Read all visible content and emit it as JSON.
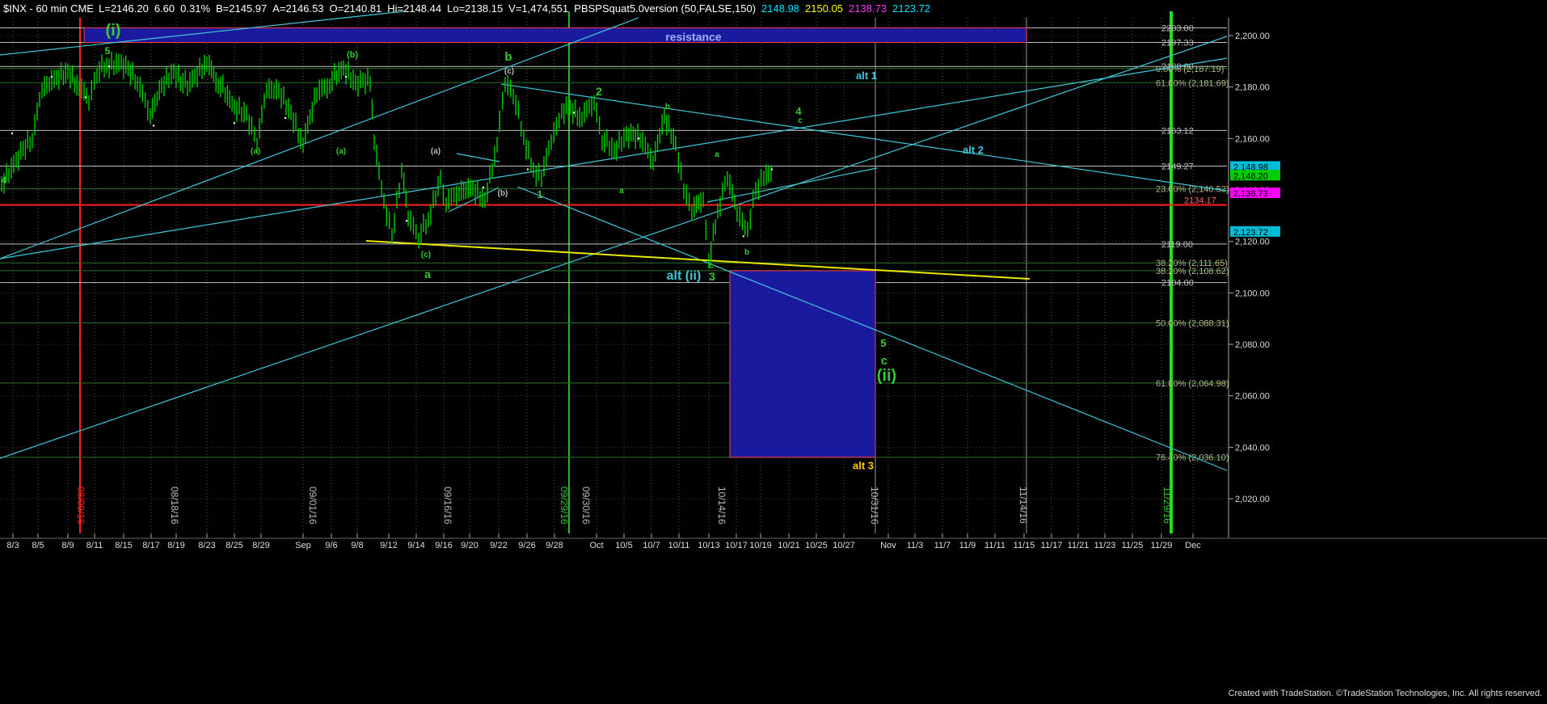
{
  "header": {
    "symbol_text": "$INX - 60 min CME",
    "fields": [
      {
        "text": "L=2146.20",
        "color": "#ffffff"
      },
      {
        "text": "6.60",
        "color": "#ffffff"
      },
      {
        "text": "0.31%",
        "color": "#ffffff"
      },
      {
        "text": "B=2145.97",
        "color": "#ffffff"
      },
      {
        "text": "A=2146.53",
        "color": "#ffffff"
      },
      {
        "text": "O=2140.81",
        "color": "#ffffff"
      },
      {
        "text": "Hi=2148.44",
        "color": "#ffffff"
      },
      {
        "text": "Lo=2138.15",
        "color": "#ffffff"
      },
      {
        "text": "V=1,474,551",
        "color": "#ffffff"
      },
      {
        "text": "PBSPSquat5.0version (50,FALSE,150)",
        "color": "#ffffff"
      },
      {
        "text": "2148.98",
        "color": "#00e5ff"
      },
      {
        "text": "2150.05",
        "color": "#ffff00"
      },
      {
        "text": "2138.73",
        "color": "#ff33ff"
      },
      {
        "text": "2123.72",
        "color": "#00e5ff"
      }
    ]
  },
  "footer": {
    "copyright": "Created with TradeStation. ©TradeStation Technologies, Inc. All rights reserved."
  },
  "colors": {
    "background": "#000000",
    "candle": "#00cc00",
    "cyan": "#3fc8d8",
    "green_label": "#33cc33",
    "red": "#ff2020",
    "yellow": "#e8e800",
    "box": "#1a1a9e"
  },
  "chart_data": {
    "type": "line",
    "title": "$INX - 60 min CME",
    "ylim": [
      2012,
      2218
    ],
    "y_axis_ticks": [
      "2,200.00",
      "2,180.00",
      "2,160.00",
      "2,140.00",
      "2,120.00",
      "2,100.00",
      "2,080.00",
      "2,060.00",
      "2,040.00",
      "2,020.00"
    ],
    "y_tick_values": [
      2200,
      2180,
      2160,
      2140,
      2120,
      2100,
      2080,
      2060,
      2040,
      2020
    ],
    "x_axis_ticks": [
      "8/3",
      "8/5",
      "8/9",
      "8/11",
      "8/15",
      "8/17",
      "8/19",
      "8/23",
      "8/25",
      "8/29",
      "Sep",
      "9/6",
      "9/8",
      "9/12",
      "9/14",
      "9/16",
      "9/20",
      "9/22",
      "9/26",
      "9/28",
      "Oct",
      "10/5",
      "10/7",
      "10/11",
      "10/13",
      "10/17",
      "10/19",
      "10/21",
      "10/25",
      "10/27",
      "Nov",
      "11/3",
      "11/7",
      "11/9",
      "11/11",
      "11/15",
      "11/17",
      "11/21",
      "11/23",
      "11/25",
      "11/29",
      "Dec"
    ],
    "vertical_date_labels": [
      {
        "text": "08/09/16",
        "color": "#ff2020"
      },
      {
        "text": "08/18/16",
        "color": "#bbbbbb"
      },
      {
        "text": "09/01/16",
        "color": "#bbbbbb"
      },
      {
        "text": "09/16/16",
        "color": "#bbbbbb"
      },
      {
        "text": "09/29/16",
        "color": "#33cc33"
      },
      {
        "text": "09/30/16",
        "color": "#bbbbbb"
      },
      {
        "text": "10/14/16",
        "color": "#bbbbbb"
      },
      {
        "text": "10/31/16",
        "color": "#bbbbbb"
      },
      {
        "text": "11/14/16",
        "color": "#bbbbbb"
      },
      {
        "text": "11/29/16",
        "color": "#33cc33"
      }
    ],
    "price_levels": [
      {
        "value": 2203.0,
        "label": "2203.00"
      },
      {
        "value": 2197.33,
        "label": "2197.33"
      },
      {
        "value": 2188.0,
        "label": "2188.00"
      },
      {
        "value": 2163.12,
        "label": "2163.12"
      },
      {
        "value": 2149.27,
        "label": "2149.27"
      },
      {
        "value": 2119.0,
        "label": "2119.00"
      },
      {
        "value": 2104.0,
        "label": "2104.00"
      }
    ],
    "fib_levels": [
      {
        "value": 2187.19,
        "label": "0.00% (2,187.19)"
      },
      {
        "value": 2181.69,
        "label": "61.80% (2,181.69)"
      },
      {
        "value": 2140.52,
        "label": "23.60% (2,140.52)"
      },
      {
        "value": 2111.65,
        "label": "38.20% (2,111.65)"
      },
      {
        "value": 2108.62,
        "label": "38.20% (2,108.62)"
      },
      {
        "value": 2088.31,
        "label": "50.00% (2,088.31)"
      },
      {
        "value": 2064.98,
        "label": "61.80% (2,064.98)"
      },
      {
        "value": 2036.1,
        "label": "76.40% (2,036.10)"
      }
    ],
    "red_level": {
      "value": 2134.17,
      "label": "2134.17"
    },
    "price_tags": [
      {
        "value": 2148.98,
        "label": "2,148.98",
        "bg": "#00bcd4",
        "fg": "#000000"
      },
      {
        "value": 2146.2,
        "label": "2,146.20",
        "bg": "#00cc00",
        "fg": "#000000"
      },
      {
        "value": 2138.73,
        "label": "2,138.73",
        "bg": "#ff00ff",
        "fg": "#000000"
      },
      {
        "value": 2123.72,
        "label": "2,123.72",
        "bg": "#00bcd4",
        "fg": "#000000"
      }
    ],
    "resistance_zone": {
      "label": "resistance",
      "from": 2203.0,
      "to": 2197.33
    },
    "target_box": {
      "from": 2108.62,
      "to": 2036.1,
      "label": "alt 3"
    },
    "wave_labels": [
      {
        "text": "(i)",
        "color": "#33cc33",
        "size": 20
      },
      {
        "text": "5",
        "color": "#33cc33",
        "size": 12
      },
      {
        "text": "(b)",
        "color": "#33cc33",
        "size": 11
      },
      {
        "text": "b",
        "color": "#33cc33",
        "size": 15
      },
      {
        "text": "(c)",
        "color": "#bbbbbb",
        "size": 10
      },
      {
        "text": "2",
        "color": "#33cc33",
        "size": 14
      },
      {
        "text": "b",
        "color": "#33cc33",
        "size": 10
      },
      {
        "text": "4",
        "color": "#33cc33",
        "size": 13
      },
      {
        "text": "c",
        "color": "#33cc33",
        "size": 10
      },
      {
        "text": "alt 1",
        "color": "#3fc8d8",
        "size": 13
      },
      {
        "text": "alt 2",
        "color": "#3fc8d8",
        "size": 13
      },
      {
        "text": "(a)",
        "color": "#33cc33",
        "size": 10
      },
      {
        "text": "(a)",
        "color": "#33cc33",
        "size": 10
      },
      {
        "text": "(a)",
        "color": "#bbbbbb",
        "size": 10
      },
      {
        "text": "(b)",
        "color": "#bbbbbb",
        "size": 10
      },
      {
        "text": "1",
        "color": "#33cc33",
        "size": 13
      },
      {
        "text": "a",
        "color": "#33cc33",
        "size": 10
      },
      {
        "text": "a",
        "color": "#33cc33",
        "size": 10
      },
      {
        "text": "(c)",
        "color": "#33cc33",
        "size": 10
      },
      {
        "text": "a",
        "color": "#33cc33",
        "size": 14
      },
      {
        "text": "b",
        "color": "#33cc33",
        "size": 10
      },
      {
        "text": "c",
        "color": "#33cc33",
        "size": 10
      },
      {
        "text": "alt (ii)",
        "color": "#3fc8d8",
        "size": 16
      },
      {
        "text": "3",
        "color": "#33cc33",
        "size": 14
      },
      {
        "text": "5",
        "color": "#33cc33",
        "size": 13
      },
      {
        "text": "c",
        "color": "#33cc33",
        "size": 15
      },
      {
        "text": "(ii)",
        "color": "#33cc33",
        "size": 20
      },
      {
        "text": "4",
        "color": "#33cc33",
        "size": 12
      }
    ]
  }
}
